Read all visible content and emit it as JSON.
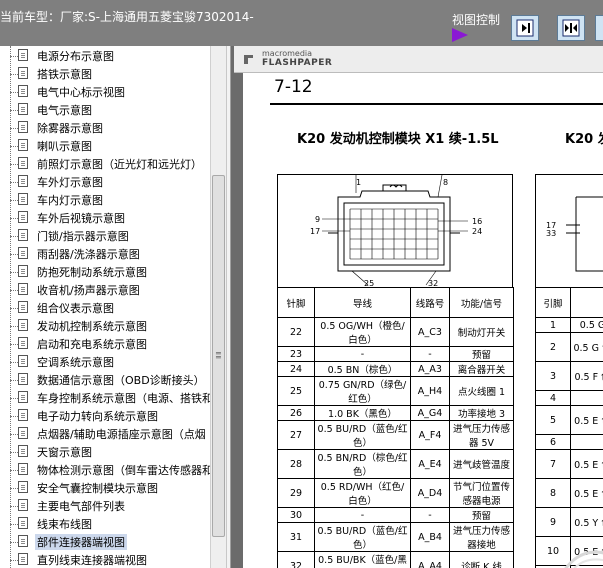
{
  "titlebar": {
    "car_info": "当前车型：厂家:S-上海通用五菱宝骏7302014-",
    "view_control_label": "视图控制"
  },
  "tree": {
    "items": [
      {
        "label": "电源分布示意图"
      },
      {
        "label": "搭铁示意图"
      },
      {
        "label": "电气中心标示视图"
      },
      {
        "label": "电气示意图"
      },
      {
        "label": "除雾器示意图"
      },
      {
        "label": "喇叭示意图"
      },
      {
        "label": "前照灯示意图（近光灯和远光灯）"
      },
      {
        "label": "车外灯示意图"
      },
      {
        "label": "车内灯示意图"
      },
      {
        "label": "车外后视镜示意图"
      },
      {
        "label": "门锁/指示器示意图"
      },
      {
        "label": "雨刮器/洗涤器示意图"
      },
      {
        "label": "防抱死制动系统示意图"
      },
      {
        "label": "收音机/扬声器示意图"
      },
      {
        "label": "组合仪表示意图"
      },
      {
        "label": "发动机控制系统示意图"
      },
      {
        "label": "启动和充电系统示意图"
      },
      {
        "label": "空调系统示意图"
      },
      {
        "label": "数据通信示意图（OBD诊断接头）"
      },
      {
        "label": "车身控制系统示意图（电源、搭铁和"
      },
      {
        "label": "电子动力转向系统示意图"
      },
      {
        "label": "点烟器/辅助电源插座示意图（点烟"
      },
      {
        "label": "天窗示意图"
      },
      {
        "label": "物体检测示意图（倒车雷达传感器和"
      },
      {
        "label": "安全气囊控制模块示意图"
      },
      {
        "label": "主要电气部件列表"
      },
      {
        "label": "线束布线图"
      },
      {
        "label": "部件连接器端视图",
        "selected": true
      },
      {
        "label": "直列线束连接器端视图"
      }
    ]
  },
  "viewer": {
    "brand_small": "macromedia",
    "brand_big": "FLASHPAPER",
    "page_title": "7-12",
    "module_title": "K20 发动机控制模块 X1 续-1.5L",
    "module_title_partial": "K20 发",
    "connector_labels": {
      "left": [
        "9",
        "17"
      ],
      "right": [
        "16",
        "24"
      ],
      "top": [
        "1",
        "8"
      ],
      "bottom": [
        "25",
        "32"
      ],
      "partial_left": [
        "17",
        "33"
      ]
    },
    "headers": [
      "针脚",
      "导线",
      "线路号",
      "功能/信号"
    ],
    "rows": [
      {
        "pin": "22",
        "wire": "0.5 OG/WH（橙色/白色）",
        "circuit": "A_C3",
        "func": "制动灯开关"
      },
      {
        "pin": "23",
        "wire": "-",
        "circuit": "-",
        "func": "预留"
      },
      {
        "pin": "24",
        "wire": "0.5 BN（棕色）",
        "circuit": "A_A3",
        "func": "离合器开关"
      },
      {
        "pin": "25",
        "wire": "0.75 GN/RD（绿色/红色）",
        "circuit": "A_H4",
        "func": "点火线圈 1"
      },
      {
        "pin": "26",
        "wire": "1.0 BK（黑色）",
        "circuit": "A_G4",
        "func": "功率接地 3"
      },
      {
        "pin": "27",
        "wire": "0.5 BU/RD（蓝色/红色）",
        "circuit": "A_F4",
        "func": "进气压力传感器 5V"
      },
      {
        "pin": "28",
        "wire": "0.5 BN/RD（棕色/红色）",
        "circuit": "A_E4",
        "func": "进气歧管温度"
      },
      {
        "pin": "29",
        "wire": "0.5 RD/WH（红色/白色）",
        "circuit": "A_D4",
        "func": "节气门位置传感器电源"
      },
      {
        "pin": "30",
        "wire": "-",
        "circuit": "-",
        "func": "预留"
      },
      {
        "pin": "31",
        "wire": "0.5 BU/RD（蓝色/红色）",
        "circuit": "A_B4",
        "func": "进气压力传感器接地"
      },
      {
        "pin": "32",
        "wire": "0.5 BU/BK（蓝色/黑色）",
        "circuit": "A_A4",
        "func": "诊断 K 线"
      }
    ],
    "partial_header": [
      "引脚",
      ""
    ],
    "partial_rows": [
      {
        "pin": "1",
        "wire": "0.5 G"
      },
      {
        "pin": "2",
        "wire": "0.5 G 色"
      },
      {
        "pin": "3",
        "wire": "0.5 F 色"
      },
      {
        "pin": "4",
        "wire": ""
      },
      {
        "pin": "5",
        "wire": "0.5 E 色"
      },
      {
        "pin": "6",
        "wire": ""
      },
      {
        "pin": "7",
        "wire": "0.5 E 色"
      },
      {
        "pin": "8",
        "wire": "0.5 E 色"
      },
      {
        "pin": "9",
        "wire": "0.5 Y 色"
      },
      {
        "pin": "10",
        "wire": "0.5 E 色"
      },
      {
        "pin": "11",
        "wire": "0.5 E"
      }
    ]
  },
  "colors": {
    "titlebar": "#7f7f7f",
    "selection_box": "#e2242c",
    "arrow": "#8a18d4"
  }
}
